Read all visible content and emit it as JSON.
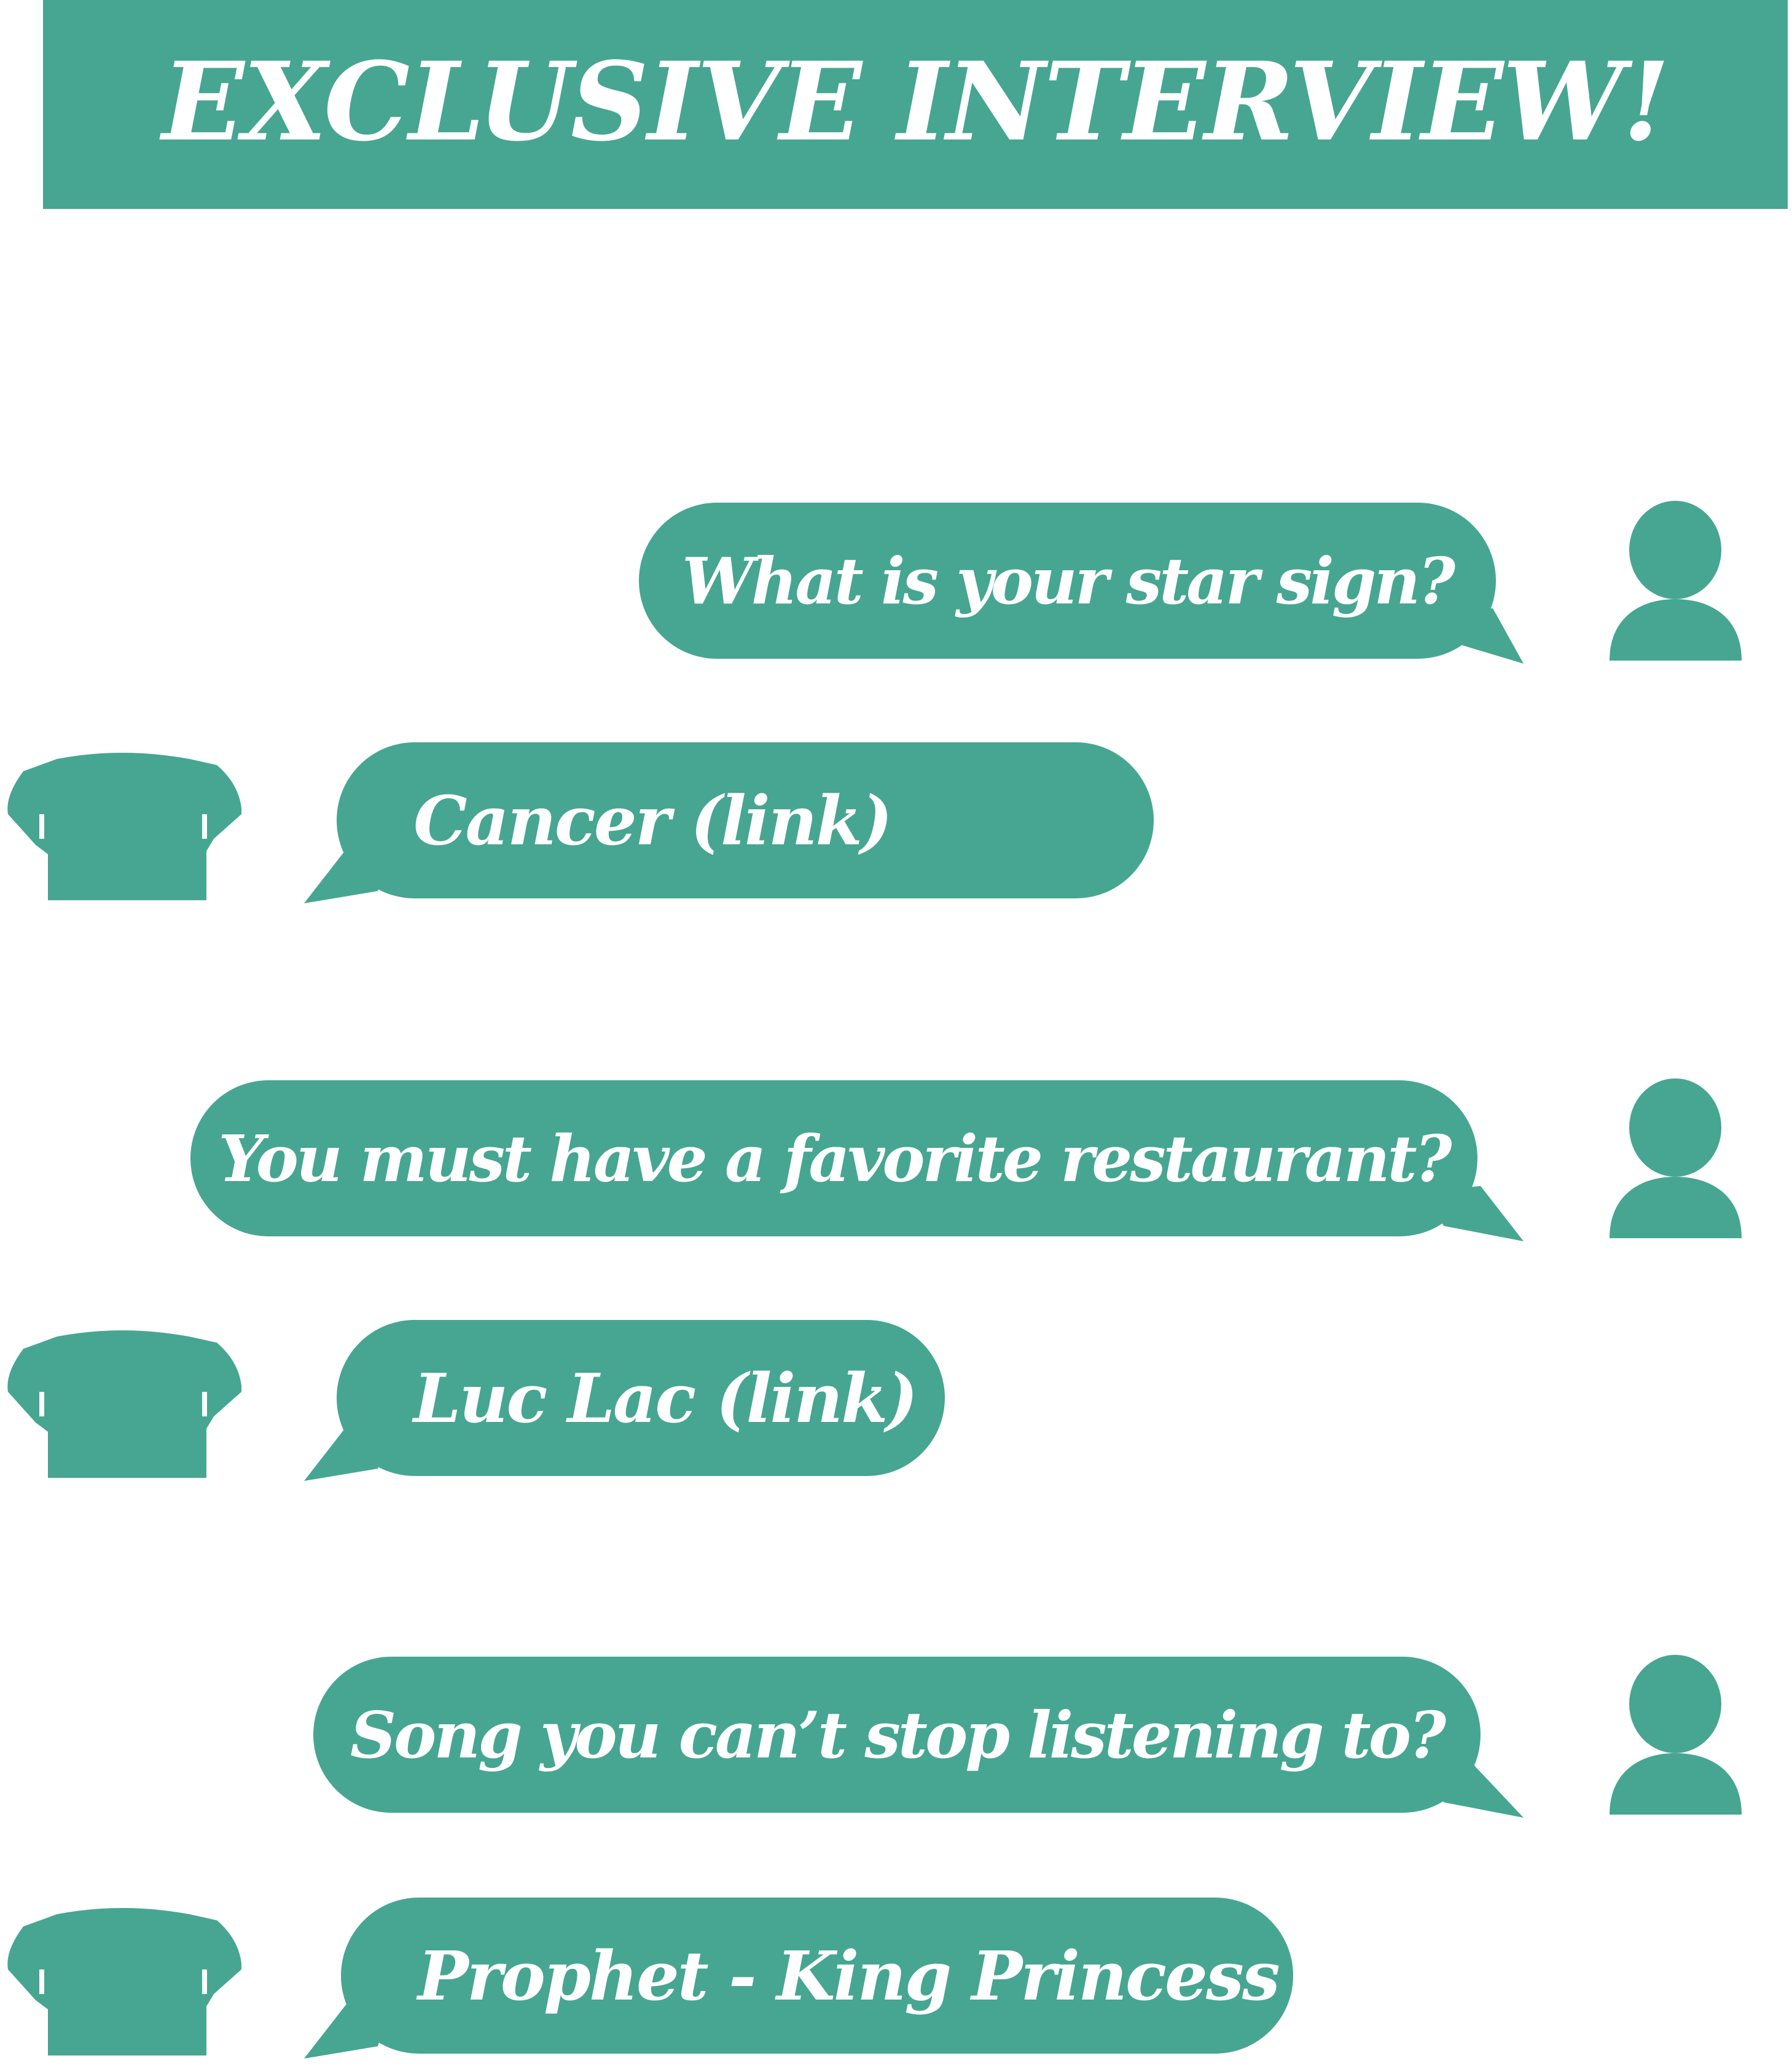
{
  "banner": {
    "title": "EXCLUSIVE INTERVIEW!"
  },
  "colors": {
    "accent": "#46a691",
    "text": "#ffffff",
    "background": "#ffffff"
  },
  "conversation": [
    {
      "role": "interviewer",
      "icon": "person-silhouette-icon",
      "text": "What is your star sign?"
    },
    {
      "role": "interviewee",
      "icon": "sweater-icon",
      "text": "Cancer (link)"
    },
    {
      "role": "interviewer",
      "icon": "person-silhouette-icon",
      "text": "You must have a favorite restaurant?"
    },
    {
      "role": "interviewee",
      "icon": "sweater-icon",
      "text": "Luc Lac (link)"
    },
    {
      "role": "interviewer",
      "icon": "person-silhouette-icon",
      "text": "Song you can’t stop listening to?"
    },
    {
      "role": "interviewee",
      "icon": "sweater-icon",
      "text": "Prophet - King Princess"
    }
  ]
}
